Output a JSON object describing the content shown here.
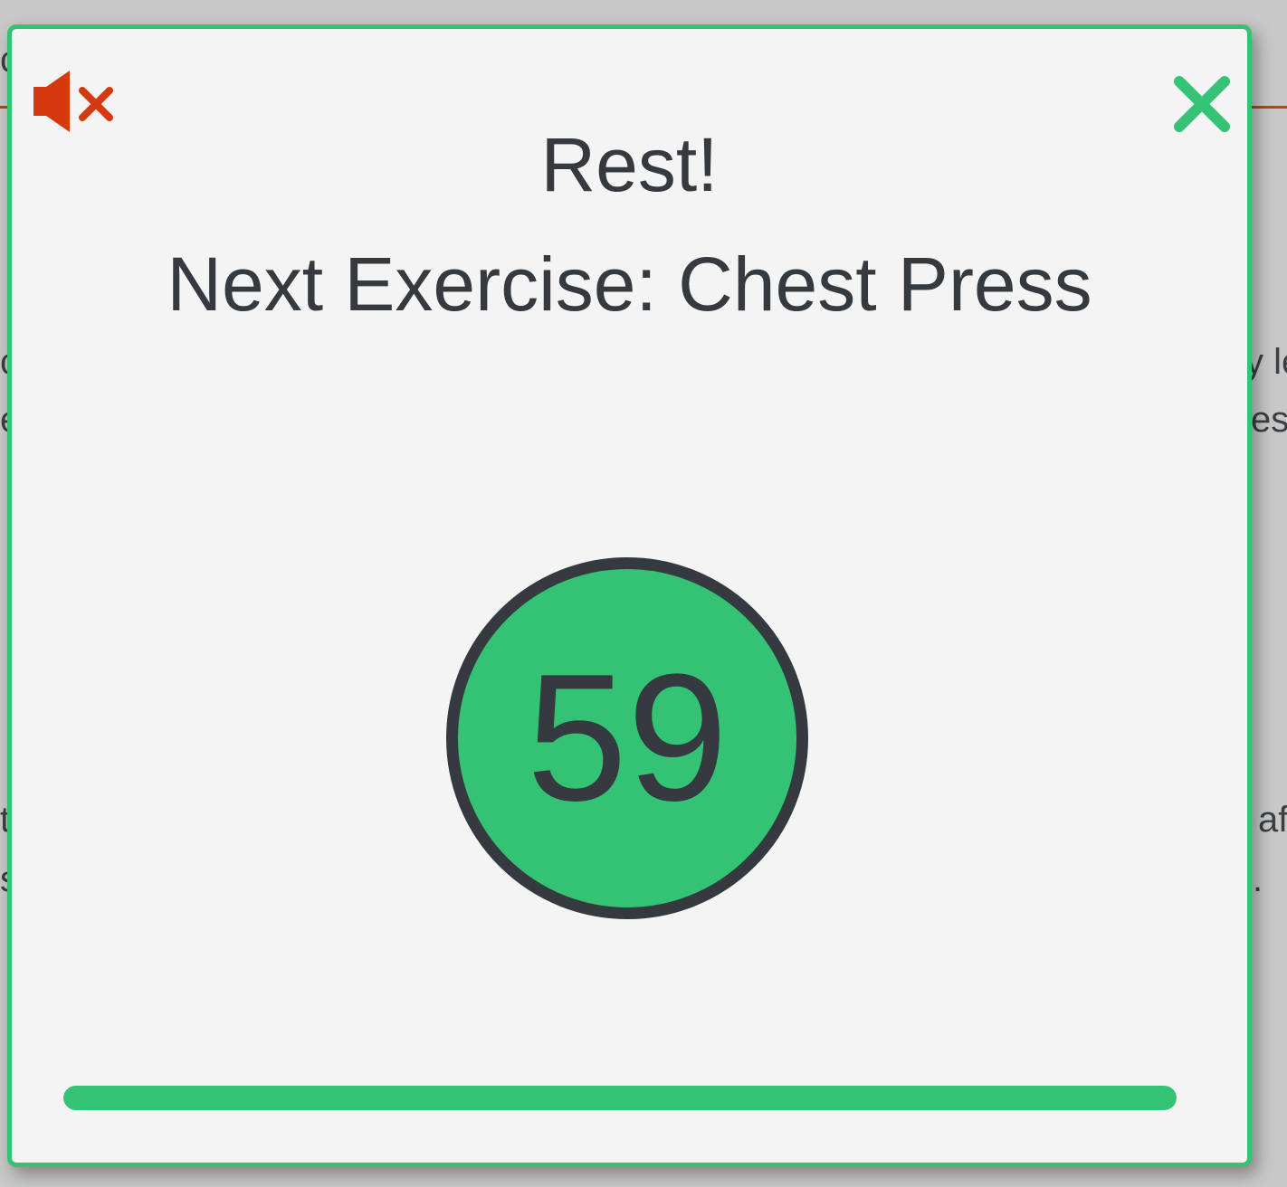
{
  "background": {
    "fragments": [
      "c",
      "c",
      "e",
      "t",
      "s",
      "y le",
      "es",
      "af",
      "."
    ]
  },
  "dialog": {
    "title": "Rest!",
    "next_exercise_text": "Next Exercise: Chest Press",
    "timer_seconds": "59",
    "progress_fraction": 1.0,
    "mute_icon": "volume-mute-icon",
    "close_icon": "close-icon"
  },
  "colors": {
    "accent": "#34c374",
    "text": "#343a3f",
    "mute_icon": "#d6380f",
    "background_line": "#c9391a",
    "dialog_bg": "#f4f4f4"
  }
}
